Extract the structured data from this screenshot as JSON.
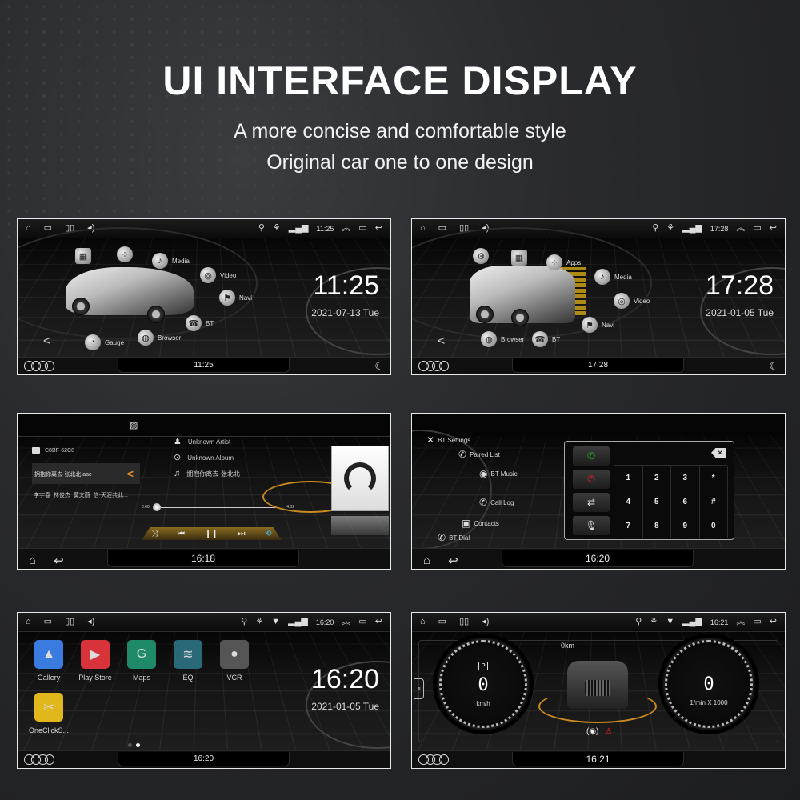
{
  "header": {
    "title": "UI INTERFACE DISPLAY",
    "subtitle_line1": "A more concise and comfortable style",
    "subtitle_line2": "Original car one to one design"
  },
  "screens": {
    "home_sedan": {
      "status_time": "11:25",
      "menu": [
        "Media",
        "Video",
        "Navi",
        "BT",
        "Browser",
        "Gauge"
      ],
      "clock": "11:25",
      "date": "2021-07-13 Tue",
      "bottom_time": "11:25"
    },
    "home_suv": {
      "status_time": "17:28",
      "menu": [
        "Apps",
        "Media",
        "Video",
        "Navi",
        "BT",
        "Browser"
      ],
      "clock": "17:28",
      "date": "2021-01-05 Tue",
      "bottom_time": "17:28"
    },
    "music": {
      "folder": "C8BF-62C8",
      "selected_track": "拥抱你离去-张北北.aac",
      "next_track": "李宇春_林俊杰_莫文蔚_信-天涯共此...",
      "artist": "Unknown Artist",
      "album": "Unknown Album",
      "song": "拥抱你离去-张北北",
      "elapsed": "0:00",
      "duration": "4:02",
      "progress": 0,
      "bottom_time": "16:18"
    },
    "bluetooth": {
      "menu": [
        "BT Settings",
        "Paired List",
        "BT Music",
        "Call Log",
        "Contacts",
        "BT Dial"
      ],
      "keys": [
        "1",
        "2",
        "3",
        "*",
        "4",
        "5",
        "6",
        "#",
        "7",
        "8",
        "9",
        "0"
      ],
      "bottom_time": "16:20"
    },
    "apps": {
      "status_time": "16:20",
      "apps": [
        {
          "label": "Gallery",
          "color": "#3a7be0",
          "glyph": "▲"
        },
        {
          "label": "Play Store",
          "color": "#d8333b",
          "glyph": "▶"
        },
        {
          "label": "Maps",
          "color": "#1f8a6a",
          "glyph": "G"
        },
        {
          "label": "EQ",
          "color": "#2a6a78",
          "glyph": "≋"
        },
        {
          "label": "VCR",
          "color": "#555555",
          "glyph": "●"
        },
        {
          "label": "OneClickS...",
          "color": "#e0b81c",
          "glyph": "✂"
        }
      ],
      "clock": "16:20",
      "date": "2021-01-05 Tue",
      "bottom_time": "16:20",
      "page": 2,
      "pages": 2
    },
    "gauge": {
      "status_time": "16:21",
      "odometer": "0km",
      "gear": "P",
      "speed": "0",
      "speed_unit": "km/h",
      "rpm": "0",
      "rpm_unit": "1/min X 1000",
      "bottom_time": "16:21"
    }
  },
  "colors": {
    "accent_orange": "#f08a2a",
    "call_green": "#22c322",
    "hangup_red": "#e02020",
    "ring_gold": "#c98a20"
  }
}
